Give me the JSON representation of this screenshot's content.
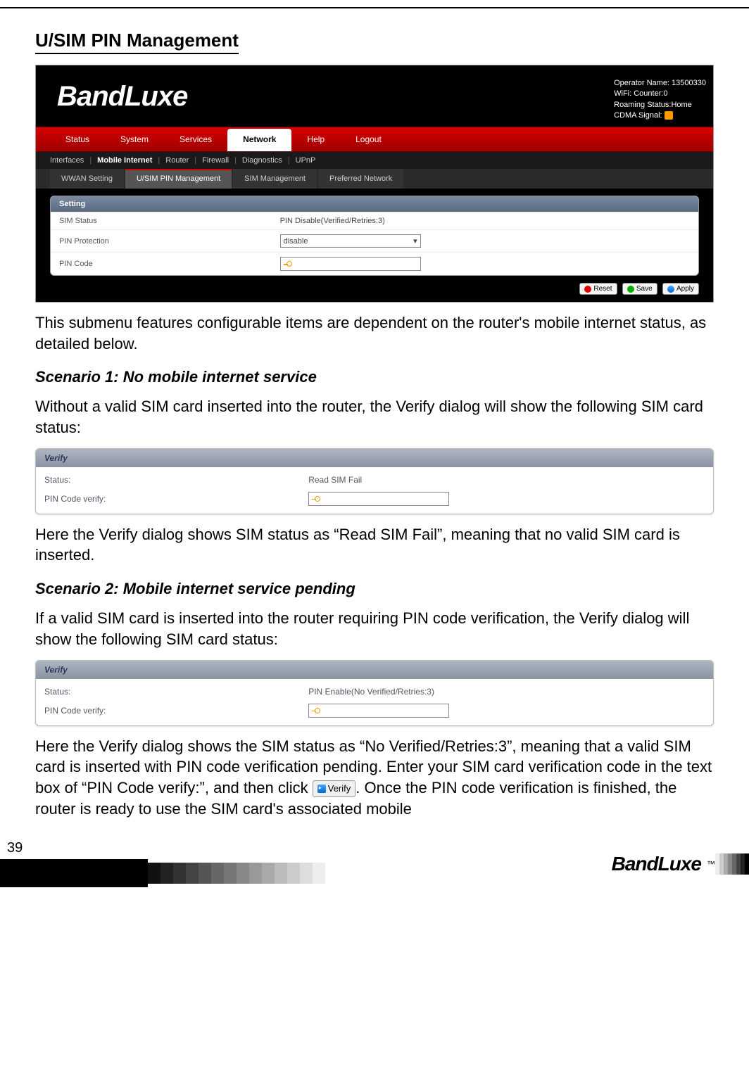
{
  "doc": {
    "section_title": "U/SIM PIN Management",
    "intro_text": "This submenu features configurable items are dependent on the router's mobile internet status, as detailed below.",
    "scenario1_title": "Scenario 1: No mobile internet service",
    "scenario1_text": "Without a valid SIM card inserted into the router, the Verify dialog will show the following SIM card status:",
    "scenario1_after": "Here the Verify dialog shows SIM status as “Read SIM Fail”, meaning that no valid SIM card is inserted.",
    "scenario2_title": "Scenario 2: Mobile internet service pending",
    "scenario2_text": "If a valid SIM card is inserted into the router requiring PIN code verification, the Verify dialog will show the following SIM card status:",
    "scenario2_after_a": "Here the Verify dialog shows the SIM status as “No Verified/Retries:3”, meaning that a valid SIM card is inserted with PIN code verification pending. Enter your SIM card verification code in the text box of “PIN Code verify:”, and then click ",
    "verify_btn_label": "Verify",
    "scenario2_after_b": ". Once the PIN code verification is finished, the router is ready to use the SIM card's associated mobile",
    "page_number": "39",
    "footer_brand": "BandLuxe",
    "footer_tm": "™"
  },
  "router": {
    "brand": "BandLuxe",
    "status": {
      "operator": "Operator Name: 13500330",
      "wifi": "WiFi: Counter:0",
      "roaming": "Roaming Status:Home",
      "cdma": "CDMA Signal:"
    },
    "main_tabs": [
      "Status",
      "System",
      "Services",
      "Network",
      "Help",
      "Logout"
    ],
    "main_active": "Network",
    "sub_tabs": [
      "Interfaces",
      "Mobile Internet",
      "Router",
      "Firewall",
      "Diagnostics",
      "UPnP"
    ],
    "sub_active": "Mobile Internet",
    "subsub": [
      "WWAN Setting",
      "U/SIM PIN Management",
      "SIM Management",
      "Preferred Network"
    ],
    "subsub_active": "U/SIM PIN Management",
    "panel": {
      "title": "Setting",
      "rows": {
        "sim_status_label": "SIM Status",
        "sim_status_value": "PIN Disable(Verified/Retries:3)",
        "pin_protection_label": "PIN Protection",
        "pin_protection_value": "disable",
        "pin_code_label": "PIN Code"
      }
    },
    "buttons": {
      "reset": "Reset",
      "save": "Save",
      "apply": "Apply"
    }
  },
  "verify1": {
    "title": "Verify",
    "status_label": "Status:",
    "status_value": "Read SIM Fail",
    "pin_label": "PIN Code verify:"
  },
  "verify2": {
    "title": "Verify",
    "status_label": "Status:",
    "status_value": "PIN Enable(No Verified/Retries:3)",
    "pin_label": "PIN Code verify:"
  }
}
